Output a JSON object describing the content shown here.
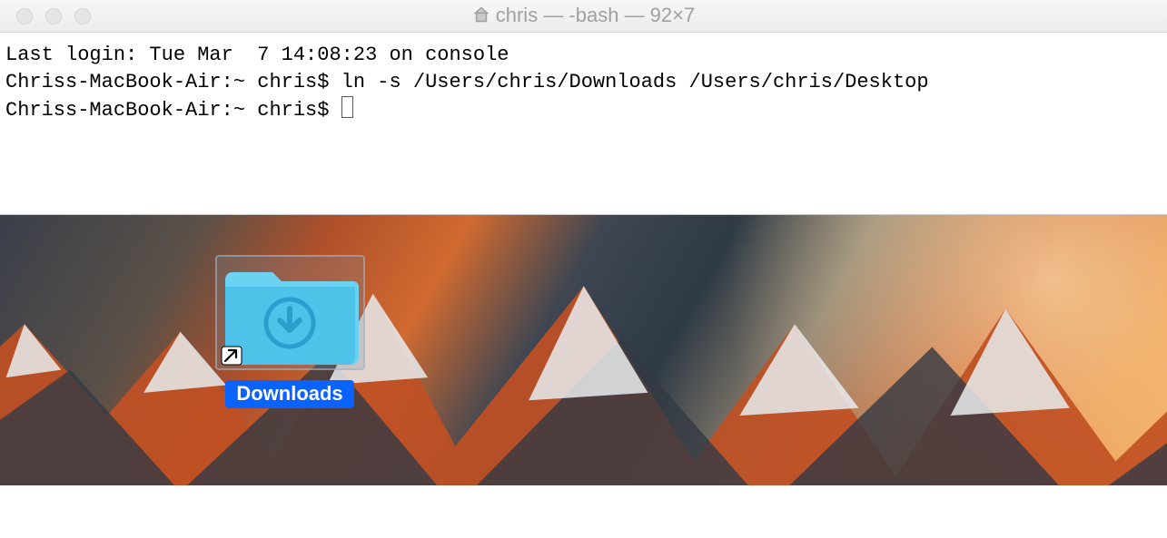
{
  "window": {
    "title": "chris — -bash — 92×7"
  },
  "terminal": {
    "line1": "Last login: Tue Mar  7 14:08:23 on console",
    "line2": "Chriss-MacBook-Air:~ chris$ ln -s /Users/chris/Downloads /Users/chris/Desktop",
    "prompt": "Chriss-MacBook-Air:~ chris$ "
  },
  "desktop": {
    "alias_label": "Downloads"
  }
}
